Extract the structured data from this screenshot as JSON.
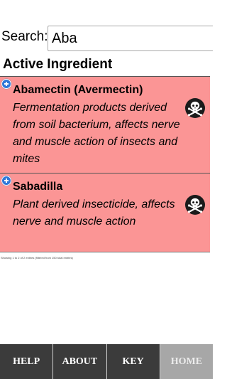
{
  "search": {
    "label": "Search:",
    "value": "Aba"
  },
  "section_heading": "Active Ingredient",
  "ingredients": [
    {
      "name": "Abamectin (Avermectin)",
      "description": "Fermentation products derived from soil bacterium, affects nerve and muscle action of insects and mites",
      "icon": "skull-crossbones-icon"
    },
    {
      "name": "Sabadilla",
      "description": "Plant derived insecticide, affects nerve and muscle action",
      "icon": "skull-crossbones-icon"
    }
  ],
  "table_info": "Showing 1 to 2 of 2 entries (filtered from 150 total entries)",
  "tabs": [
    {
      "label": "HELP"
    },
    {
      "label": "ABOUT"
    },
    {
      "label": "KEY"
    },
    {
      "label": "HOME"
    }
  ],
  "colors": {
    "row_background": "#fb9595",
    "tabbar": "#3b3b3b",
    "active_tab": "#a7a7a7",
    "expand_icon": "#2f78d8"
  }
}
